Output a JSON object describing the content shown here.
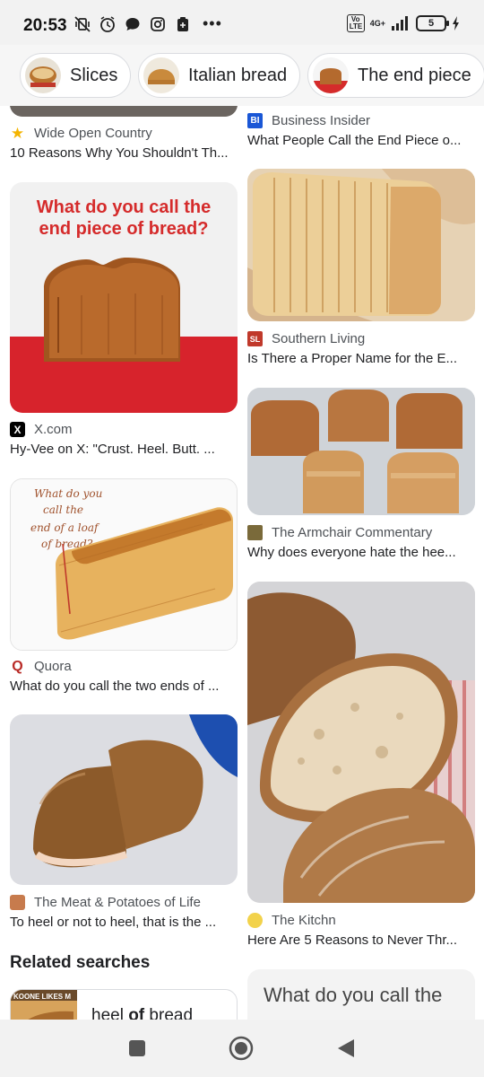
{
  "status_bar": {
    "time": "20:53",
    "network_badge": "Vo LTE",
    "network_type": "4G+",
    "battery_level": "5"
  },
  "chips": [
    {
      "label": "Slices"
    },
    {
      "label": "Italian bread"
    },
    {
      "label": "The end piece"
    }
  ],
  "results": {
    "left": [
      {
        "source": "Wide Open Country",
        "title": "10 Reasons Why You Shouldn't Th..."
      },
      {
        "source": "X.com",
        "title": "Hy-Vee on X: \"Crust. Heel. Butt. ...",
        "image_text": [
          "What do you call the",
          "end piece of bread?"
        ]
      },
      {
        "source": "Quora",
        "title": "What do you call the two ends of ...",
        "image_text": [
          "What do you",
          "call the",
          "end of a loaf",
          "of bread?"
        ]
      },
      {
        "source": "The Meat & Potatoes of Life",
        "title": "To heel or not to heel, that is the ..."
      }
    ],
    "right": [
      {
        "source": "Business Insider",
        "source_icon": "BI",
        "title": "What People Call the End Piece o..."
      },
      {
        "source": "Southern Living",
        "source_icon": "SL",
        "title": "Is There a Proper Name for the E..."
      },
      {
        "source": "The Armchair Commentary",
        "title": "Why does everyone hate the hee..."
      },
      {
        "source": "The Kitchn",
        "title": "Here Are 5 Reasons to Never Thr..."
      }
    ]
  },
  "related": {
    "heading": "Related searches",
    "items": [
      {
        "prefix": "heel ",
        "bold": "of",
        "suffix": " bread",
        "thumb_text": "KOONE LIKES M"
      }
    ]
  },
  "peek_card": {
    "text": "What do you call the"
  },
  "colors": {
    "accent_red": "#d52b2b",
    "bi_blue": "#1a57d6",
    "quora_red": "#b92b27",
    "star_yellow": "#f4b400"
  },
  "icons": {
    "status_left": [
      "mute-vibrate-icon",
      "alarm-icon",
      "chat-icon",
      "instagram-icon",
      "clipboard-icon",
      "more-icon"
    ],
    "nav": [
      "recent-apps-icon",
      "home-icon",
      "back-icon"
    ]
  }
}
